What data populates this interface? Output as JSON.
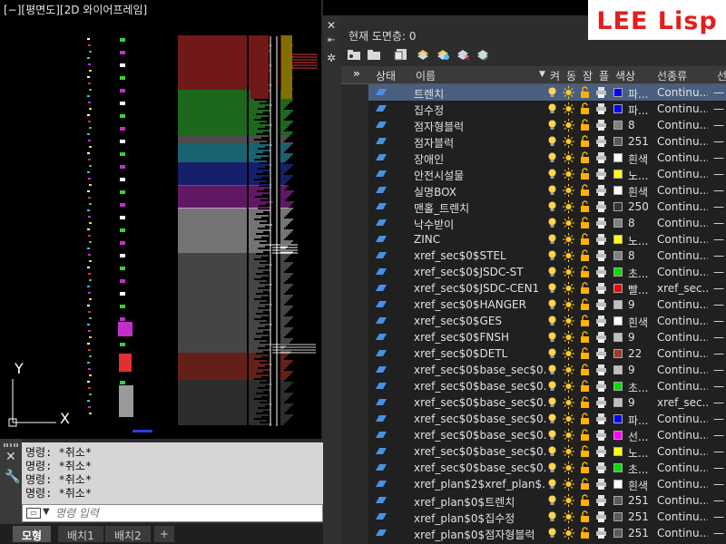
{
  "viewport": {
    "label": "[−][평면도][2D 와이어프레임]"
  },
  "ucs": {
    "y_label": "Y",
    "x_label": "X"
  },
  "command": {
    "history": [
      "명령: *취소*",
      "명령: *취소*",
      "명령: *취소*",
      "명령: *취소*"
    ],
    "placeholder": "명령 입력"
  },
  "tabs": {
    "model": "모형",
    "layout1": "배치1",
    "layout2": "배치2",
    "add": "+"
  },
  "watermark": {
    "text": "LEE Lisp",
    "color": "#e31e1e"
  },
  "layer_panel": {
    "current_layer": "현재 도면층: 0",
    "toolbar_icons": [
      "new-property-filter-icon",
      "new-group-filter-icon",
      "layer-states-manager-icon",
      "new-layer-icon",
      "new-layer-vp-frozen-icon",
      "delete-layer-icon",
      "set-current-icon"
    ],
    "headers": {
      "status": "상태",
      "name": "이름",
      "on": "켜",
      "freeze": "동",
      "lock": "잠",
      "plot": "플",
      "color": "색상",
      "linetype": "선종류",
      "lineweight": "선"
    },
    "rows": [
      {
        "name": "트렌치",
        "color_label": "파...",
        "color": "#0000ff",
        "linetype": "Continu...",
        "selected": true
      },
      {
        "name": "집수정",
        "color_label": "파...",
        "color": "#0000ff",
        "linetype": "Continu..."
      },
      {
        "name": "점자형블럭",
        "color_label": "8",
        "color": "#808080",
        "linetype": "Continu..."
      },
      {
        "name": "점자블럭",
        "color_label": "251",
        "color": "#5a5a5a",
        "linetype": "Continu..."
      },
      {
        "name": "장애인",
        "color_label": "흰색",
        "color": "#ffffff",
        "linetype": "Continu..."
      },
      {
        "name": "안전시설물",
        "color_label": "노...",
        "color": "#ffff00",
        "linetype": "Continu..."
      },
      {
        "name": "실명BOX",
        "color_label": "흰색",
        "color": "#ffffff",
        "linetype": "Continu..."
      },
      {
        "name": "맨홀_트렌치",
        "color_label": "250",
        "color": "#333333",
        "linetype": "Continu..."
      },
      {
        "name": "낙수받이",
        "color_label": "8",
        "color": "#808080",
        "linetype": "Continu..."
      },
      {
        "name": "ZINC",
        "color_label": "노...",
        "color": "#ffff00",
        "linetype": "Continu..."
      },
      {
        "name": "xref_sec$0$STEL",
        "color_label": "8",
        "color": "#808080",
        "linetype": "Continu..."
      },
      {
        "name": "xref_sec$0$JSDC-ST",
        "color_label": "초...",
        "color": "#00dd00",
        "linetype": "Continu..."
      },
      {
        "name": "xref_sec$0$JSDC-CEN1",
        "color_label": "빨...",
        "color": "#ff0000",
        "linetype": "xref_sec..."
      },
      {
        "name": "xref_sec$0$HANGER",
        "color_label": "9",
        "color": "#c0c0c0",
        "linetype": "Continu..."
      },
      {
        "name": "xref_sec$0$GES",
        "color_label": "흰색",
        "color": "#ffffff",
        "linetype": "Continu..."
      },
      {
        "name": "xref_sec$0$FNSH",
        "color_label": "9",
        "color": "#c0c0c0",
        "linetype": "Continu..."
      },
      {
        "name": "xref_sec$0$DETL",
        "color_label": "22",
        "color": "#a03c28",
        "linetype": "Continu..."
      },
      {
        "name": "xref_sec$0$base_sec$0...",
        "color_label": "9",
        "color": "#c0c0c0",
        "linetype": "Continu..."
      },
      {
        "name": "xref_sec$0$base_sec$0...",
        "color_label": "초...",
        "color": "#00dd00",
        "linetype": "Continu..."
      },
      {
        "name": "xref_sec$0$base_sec$0...",
        "color_label": "9",
        "color": "#c0c0c0",
        "linetype": "xref_sec..."
      },
      {
        "name": "xref_sec$0$base_sec$0...",
        "color_label": "파...",
        "color": "#0000ff",
        "linetype": "Continu..."
      },
      {
        "name": "xref_sec$0$base_sec$0...",
        "color_label": "선...",
        "color": "#ff00ff",
        "linetype": "Continu..."
      },
      {
        "name": "xref_sec$0$base_sec$0...",
        "color_label": "노...",
        "color": "#ffff00",
        "linetype": "Continu..."
      },
      {
        "name": "xref_sec$0$base_sec$0...",
        "color_label": "초...",
        "color": "#00dd00",
        "linetype": "Continu..."
      },
      {
        "name": "xref_plan$2$xref_plan$...",
        "color_label": "흰색",
        "color": "#ffffff",
        "linetype": "Continu..."
      },
      {
        "name": "xref_plan$0$트렌치",
        "color_label": "251",
        "color": "#5a5a5a",
        "linetype": "Continu..."
      },
      {
        "name": "xref_plan$0$집수정",
        "color_label": "251",
        "color": "#5a5a5a",
        "linetype": "Continu..."
      },
      {
        "name": "xref_plan$0$점자형블럭",
        "color_label": "251",
        "color": "#5a5a5a",
        "linetype": "Continu..."
      }
    ]
  }
}
